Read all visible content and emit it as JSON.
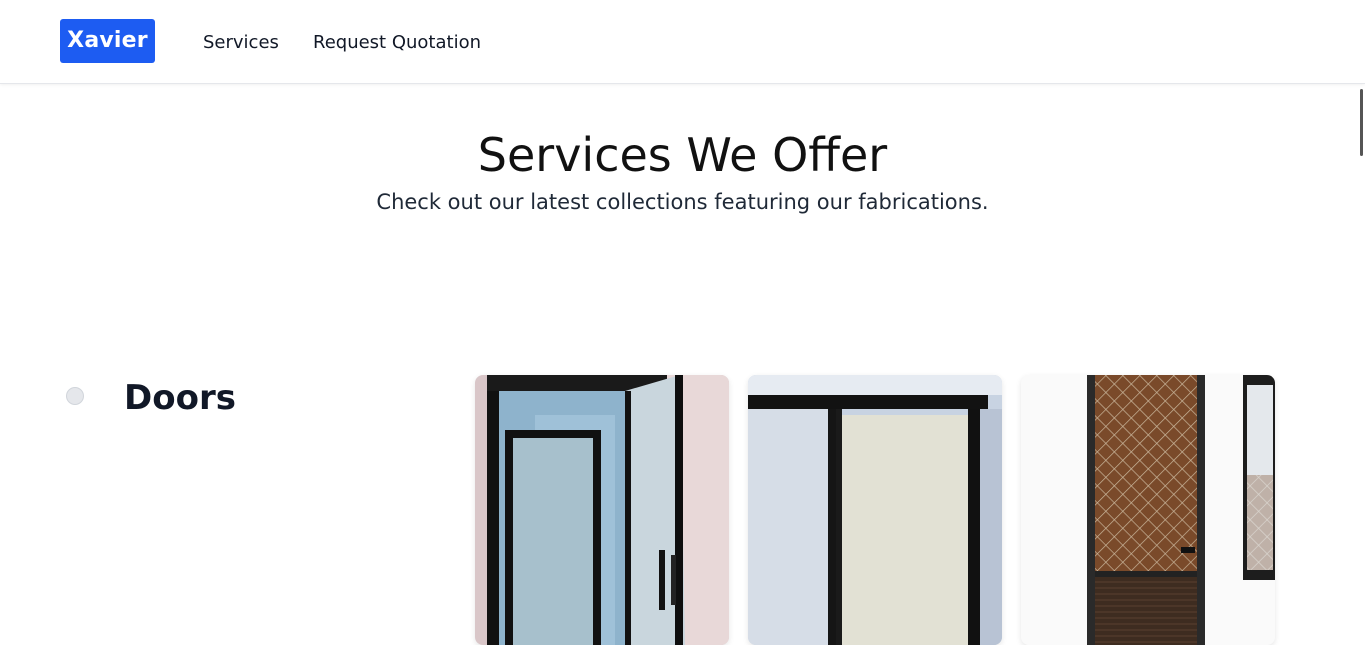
{
  "header": {
    "brand": "Xavier",
    "nav": {
      "services": "Services",
      "request_quotation": "Request Quotation"
    }
  },
  "hero": {
    "title": "Services We Offer",
    "subtitle": "Check out our latest collections featuring our fabrications."
  },
  "section": {
    "title": "Doors",
    "images": [
      {
        "name": "door-photo-1"
      },
      {
        "name": "door-photo-2"
      },
      {
        "name": "door-photo-3"
      }
    ]
  },
  "colors": {
    "brand": "#1d5cf2",
    "text": "#111827"
  }
}
